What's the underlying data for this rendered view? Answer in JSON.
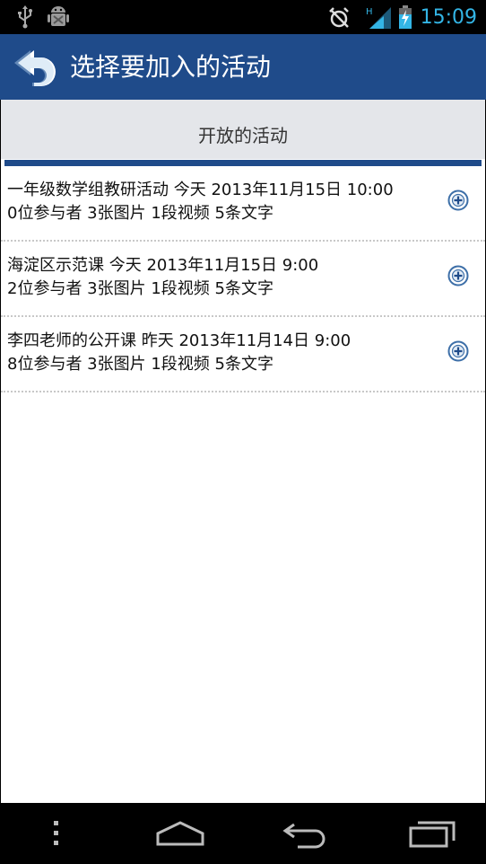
{
  "status_bar": {
    "time": "15:09",
    "icons": [
      "usb-icon",
      "android-debug-icon",
      "alarm-icon",
      "signal-icon",
      "battery-icon"
    ],
    "signal_type": "H"
  },
  "app_bar": {
    "title": "选择要加入的活动",
    "back_icon": "back-arrow-icon",
    "color": "#1f4b8a"
  },
  "section": {
    "title": "开放的活动"
  },
  "activities": [
    {
      "line1": "一年级数学组教研活动 今天 2013年11月15日  10:00",
      "line2": "0位参与者 3张图片 1段视频 5条文字",
      "action_icon": "add-circle-icon"
    },
    {
      "line1": "海淀区示范课 今天 2013年11月15日 9:00",
      "line2": "2位参与者 3张图片 1段视频 5条文字",
      "action_icon": "add-circle-icon"
    },
    {
      "line1": "李四老师的公开课 昨天 2013年11月14日 9:00",
      "line2": "8位参与者 3张图片 1段视频 5条文字",
      "action_icon": "add-circle-icon"
    }
  ],
  "nav_bar": {
    "icons": [
      "menu-icon",
      "home-icon",
      "back-icon",
      "recent-apps-icon"
    ]
  }
}
